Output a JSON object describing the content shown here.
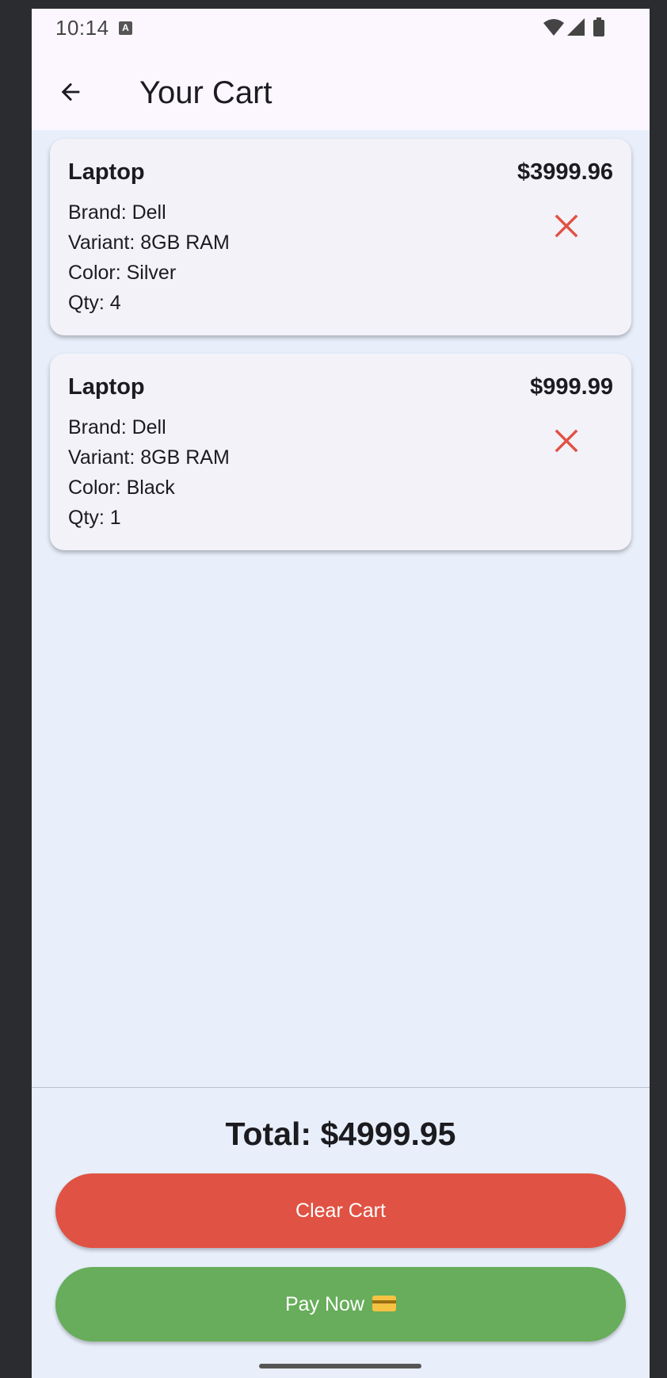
{
  "status_bar": {
    "time": "10:14",
    "notification_icon": "A"
  },
  "app_bar": {
    "title": "Your Cart"
  },
  "cart_items": [
    {
      "name": "Laptop",
      "price": "$3999.96",
      "brand": "Brand: Dell",
      "variant": "Variant: 8GB RAM",
      "color": "Color: Silver",
      "qty": "Qty: 4"
    },
    {
      "name": "Laptop",
      "price": "$999.99",
      "brand": "Brand: Dell",
      "variant": "Variant: 8GB RAM",
      "color": "Color: Black",
      "qty": "Qty: 1"
    }
  ],
  "footer": {
    "total": "Total: $4999.95",
    "clear_label": "Clear Cart",
    "pay_label": "Pay Now"
  },
  "colors": {
    "remove": "#e05243",
    "clear": "#e05243",
    "pay": "#67ad5b",
    "background": "#e8effb"
  },
  "icons": {
    "back": "arrow-back-icon",
    "remove": "close-icon",
    "pay": "credit-card-emoji"
  }
}
